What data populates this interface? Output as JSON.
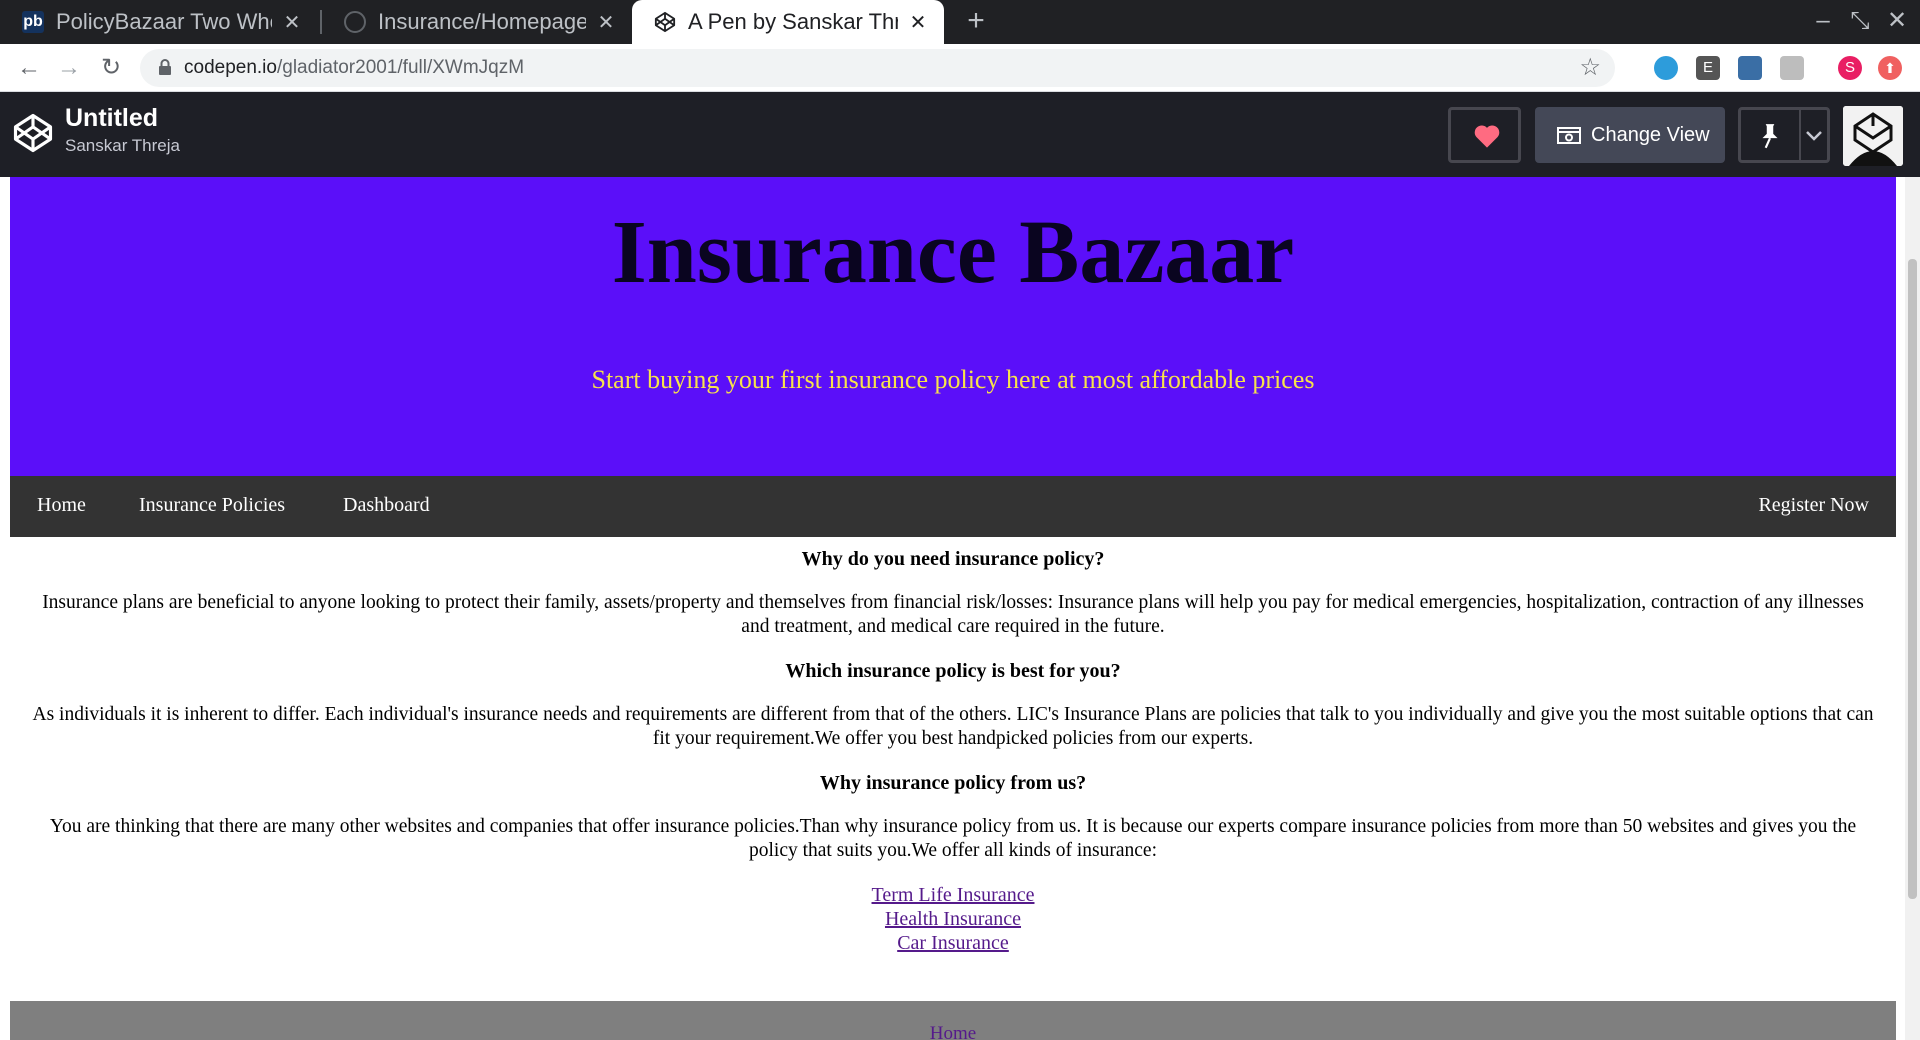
{
  "browser": {
    "tabs": [
      {
        "title": "PolicyBazaar Two Wheel",
        "favicon": "pb"
      },
      {
        "title": "Insurance/Homepage at",
        "favicon": "github-icon"
      },
      {
        "title": "A Pen by Sanskar Threja",
        "favicon": "codepen-icon",
        "active": true
      }
    ],
    "url_host": "codepen.io",
    "url_path": "/gladiator2001/full/XWmJqzM",
    "extensions": [
      {
        "label": "",
        "color": "#2d9cdb",
        "icon": "extension-icon"
      },
      {
        "label": "E",
        "color": "#555555",
        "icon": "extension-icon"
      },
      {
        "label": "",
        "color": "#3a6ea5",
        "icon": "extension-icon"
      },
      {
        "label": "",
        "color": "#bdbdbd",
        "icon": "extension-icon"
      }
    ],
    "profile_initial": "S"
  },
  "codepen": {
    "title": "Untitled",
    "author": "Sanskar Threja",
    "change_view_label": "Change View"
  },
  "page": {
    "banner_title": "Insurance Bazaar",
    "banner_subtitle": "Start buying your first insurance policy here at most affordable prices",
    "nav": {
      "home": "Home",
      "policies": "Insurance Policies",
      "dashboard": "Dashboard",
      "register": "Register Now"
    },
    "sections": [
      {
        "heading": "Why do you need insurance policy?",
        "text": "Insurance plans are beneficial to anyone looking to protect their family, assets/property and themselves from financial risk/losses: Insurance plans will help you pay for medical emergencies, hospitalization, contraction of any illnesses and treatment, and medical care required in the future."
      },
      {
        "heading": "Which insurance policy is best for you?",
        "text": "As individuals it is inherent to differ. Each individual's insurance needs and requirements are different from that of the others. LIC's Insurance Plans are policies that talk to you individually and give you the most suitable options that can fit your requirement.We offer you best handpicked policies from our experts."
      },
      {
        "heading": "Why insurance policy from us?",
        "text": "You are thinking that there are many other websites and companies that offer insurance policies.Than why insurance policy from us. It is because our experts compare insurance policies from more than 50 websites and gives you the policy that suits you.We offer all kinds of insurance:"
      }
    ],
    "links": [
      "Term Life Insurance",
      "Health Insurance",
      "Car Insurance"
    ],
    "footer_link": "Home"
  },
  "colors": {
    "banner_bg": "#5b0ff9",
    "subtitle": "#f7e34a",
    "navbar_bg": "#333333",
    "footer_bg": "#7f7f7f",
    "heart": "#ff6b81"
  }
}
